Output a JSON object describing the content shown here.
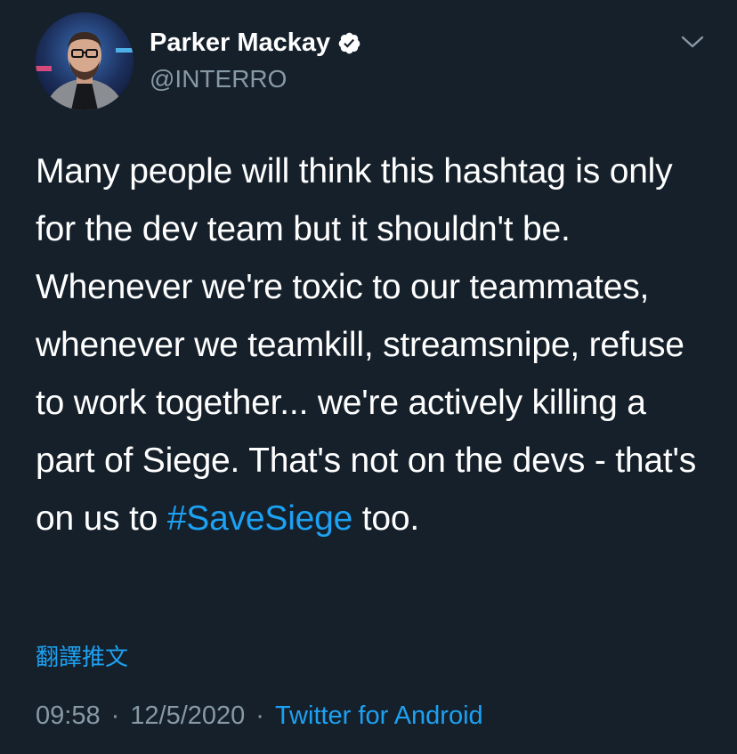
{
  "author": {
    "name": "Parker Mackay",
    "handle": "@INTERRO",
    "verified": true
  },
  "tweet": {
    "text_before_hashtag": "Many people will think this hashtag is only for the dev team but it shouldn't be. Whenever we're toxic to our teammates, whenever we teamkill, streamsnipe, refuse to work together... we're actively killing a part of Siege. That's not on the devs - that's on us to ",
    "hashtag": "#SaveSiege",
    "text_after_hashtag": " too."
  },
  "translate_label": "翻譯推文",
  "meta": {
    "time": "09:58",
    "separator": "·",
    "date": "12/5/2020",
    "source": "Twitter for Android"
  },
  "colors": {
    "background": "#15202b",
    "accent": "#1da1f2",
    "muted": "#8899a6",
    "text": "#ffffff"
  },
  "icons": {
    "verified": "verified-badge-icon",
    "menu": "chevron-down-icon"
  }
}
